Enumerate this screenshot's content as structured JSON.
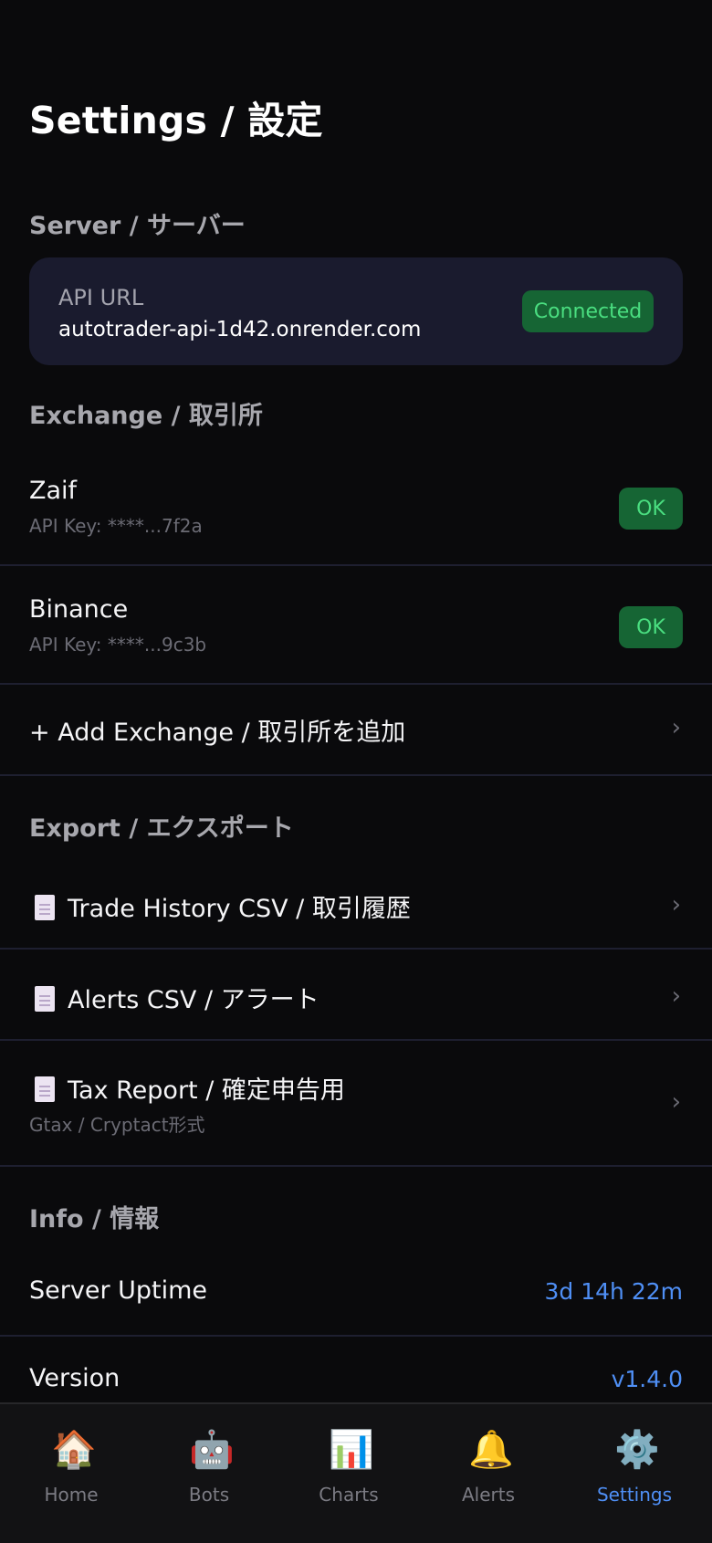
{
  "page": {
    "title": "Settings / 設定"
  },
  "server": {
    "section_title": "Server / サーバー",
    "api_label": "API URL",
    "api_url": "autotrader-api-1d42.onrender.com",
    "status": "Connected"
  },
  "exchange": {
    "section_title": "Exchange / 取引所",
    "items": [
      {
        "name": "Zaif",
        "api_key": "API Key: ****...7f2a",
        "status": "OK"
      },
      {
        "name": "Binance",
        "api_key": "API Key: ****...9c3b",
        "status": "OK"
      }
    ],
    "add_label": "+ Add Exchange / 取引所を追加"
  },
  "export": {
    "section_title": "Export / エクスポート",
    "items": [
      {
        "label": "Trade History CSV / 取引履歴"
      },
      {
        "label": "Alerts CSV / アラート"
      },
      {
        "label": "Tax Report / 確定申告用",
        "sub": "Gtax / Cryptact形式"
      }
    ]
  },
  "info": {
    "section_title": "Info / 情報",
    "uptime_label": "Server Uptime",
    "uptime_value": "3d 14h 22m",
    "version_label": "Version",
    "version_value": "v1.4.0"
  },
  "chevron": "›",
  "tabbar": {
    "items": [
      {
        "label": "Home",
        "icon": "house-icon",
        "glyph": "🏠"
      },
      {
        "label": "Bots",
        "icon": "robot-icon",
        "glyph": "🤖"
      },
      {
        "label": "Charts",
        "icon": "bar-chart-icon",
        "glyph": "📊"
      },
      {
        "label": "Alerts",
        "icon": "bell-icon",
        "glyph": "🔔"
      },
      {
        "label": "Settings",
        "icon": "gear-icon",
        "glyph": "⚙️"
      }
    ],
    "active": "Settings"
  },
  "colors": {
    "background": "#0a0a0c",
    "card": "#1a1b2e",
    "accent": "#4f8ff5",
    "success_bg": "#166534",
    "success_text": "#4ade80"
  }
}
